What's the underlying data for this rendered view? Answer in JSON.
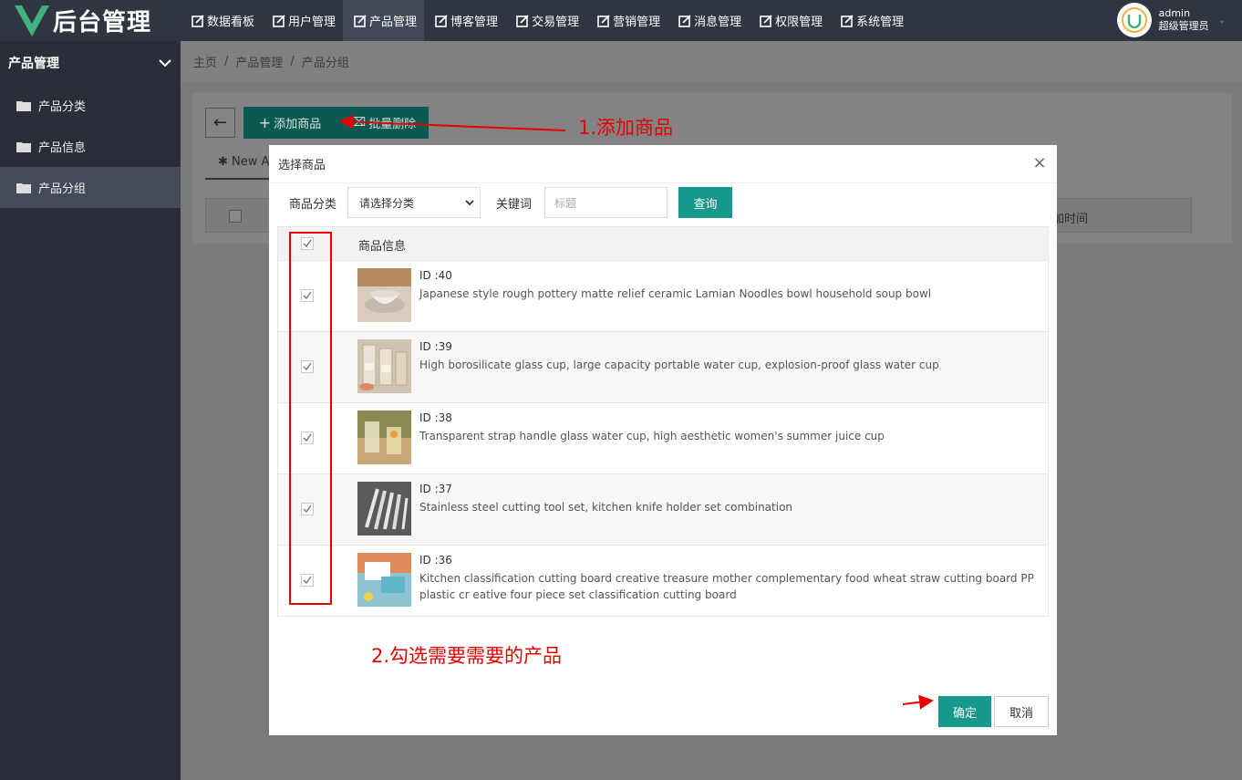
{
  "header": {
    "logo_text": "后台管理",
    "nav": [
      {
        "label": "数据看板"
      },
      {
        "label": "用户管理"
      },
      {
        "label": "产品管理"
      },
      {
        "label": "博客管理"
      },
      {
        "label": "交易管理"
      },
      {
        "label": "营销管理"
      },
      {
        "label": "消息管理"
      },
      {
        "label": "权限管理"
      },
      {
        "label": "系统管理"
      }
    ],
    "active_nav_index": 2,
    "user": {
      "name": "admin",
      "role": "超级管理员"
    }
  },
  "sidebar": {
    "title": "产品管理",
    "items": [
      {
        "label": "产品分类"
      },
      {
        "label": "产品信息"
      },
      {
        "label": "产品分组"
      }
    ],
    "active_index": 2
  },
  "breadcrumb": [
    "主页",
    "产品管理",
    "产品分组"
  ],
  "toolbar": {
    "add_label": "添加商品",
    "delete_label": "批量删除",
    "tab_label": "New A",
    "table_time_col": "加时间"
  },
  "annotations": {
    "step1": "1.添加商品",
    "step2": "2.勾选需要需要的产品",
    "color": "#e60000"
  },
  "modal": {
    "title": "选择商品",
    "filter": {
      "category_label": "商品分类",
      "category_value": "请选择分类",
      "keyword_label": "关键词",
      "keyword_placeholder": "标题",
      "search_label": "查询"
    },
    "table": {
      "header_label": "商品信息",
      "rows": [
        {
          "id": "ID :40",
          "name": "Japanese style rough pottery matte relief ceramic Lamian Noodles bowl household soup bowl",
          "checked": true
        },
        {
          "id": "ID :39",
          "name": "High borosilicate glass cup, large capacity portable water cup, explosion-proof glass water cup",
          "checked": true
        },
        {
          "id": "ID :38",
          "name": "Transparent strap handle glass water cup, high aesthetic women's summer juice cup",
          "checked": true
        },
        {
          "id": "ID :37",
          "name": "Stainless steel cutting tool set, kitchen knife holder set combination",
          "checked": true
        },
        {
          "id": "ID :36",
          "name": "Kitchen classification cutting board creative treasure mother complementary food wheat straw cutting board PP plastic cr eative four piece set classification cutting board",
          "checked": true
        }
      ]
    },
    "ok_label": "确定",
    "cancel_label": "取消"
  },
  "colors": {
    "header_bg": "#2f3541",
    "sidebar_bg": "#2b2e38",
    "accent": "#16998a"
  }
}
